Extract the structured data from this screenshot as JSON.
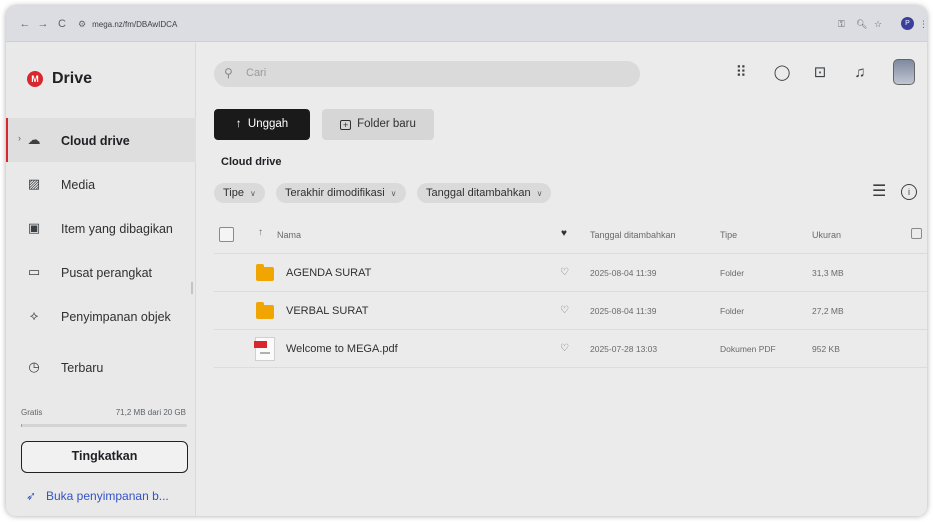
{
  "browser": {
    "back": "←",
    "forward": "→",
    "reload": "C",
    "url": "mega.nz/fm/DBAwIDCA",
    "right_icons": [
      "key-icon",
      "zoom-icon",
      "star-icon"
    ],
    "zoom_text": "⊕ Q",
    "star": "☆",
    "menu": "⋮",
    "profile_letter": "P"
  },
  "sidebar": {
    "logo_letter": "M",
    "brand": "Drive",
    "items": [
      {
        "label": "Cloud drive",
        "icon": "cloud-icon",
        "glyph": "☁",
        "active": true
      },
      {
        "label": "Media",
        "icon": "image-icon",
        "glyph": "▨",
        "active": false
      },
      {
        "label": "Item yang dibagikan",
        "icon": "shared-folder-icon",
        "glyph": "▣",
        "active": false
      },
      {
        "label": "Pusat perangkat",
        "icon": "devices-icon",
        "glyph": "▭",
        "active": false
      },
      {
        "label": "Penyimpanan objek",
        "icon": "object-storage-icon",
        "glyph": "⟡",
        "active": false
      },
      {
        "label": "Terbaru",
        "icon": "clock-icon",
        "glyph": "◷",
        "active": false
      }
    ],
    "storage_plan": "Gratis",
    "storage_usage": "71,2 MB dari 20 GB",
    "storage_fraction": 0.0036,
    "upgrade_label": "Tingkatkan",
    "open_storage_label": "Buka penyimpanan b..."
  },
  "main": {
    "search_placeholder": "Cari",
    "upload_label": "Unggah",
    "new_folder_label": "Folder baru",
    "section_title": "Cloud drive",
    "filters": [
      "Tipe",
      "Terakhir dimodifikasi",
      "Tanggal ditambahkan"
    ],
    "columns": {
      "name": "Nama",
      "date_added": "Tanggal ditambahkan",
      "type": "Tipe",
      "size": "Ukuran"
    },
    "rows": [
      {
        "name": "AGENDA SURAT",
        "kind": "folder",
        "date": "2025-08-04 11:39",
        "type": "Folder",
        "size": "31,3 MB"
      },
      {
        "name": "VERBAL SURAT",
        "kind": "folder",
        "date": "2025-08-04 11:39",
        "type": "Folder",
        "size": "27,2 MB"
      },
      {
        "name": "Welcome to MEGA.pdf",
        "kind": "pdf",
        "date": "2025-07-28 13:03",
        "type": "Dokumen PDF",
        "size": "952 KB"
      }
    ]
  },
  "colors": {
    "accent_red": "#d9272e",
    "folder_yellow": "#f0a500",
    "link_blue": "#3453c7",
    "primary_button": "#1a1a1a"
  }
}
